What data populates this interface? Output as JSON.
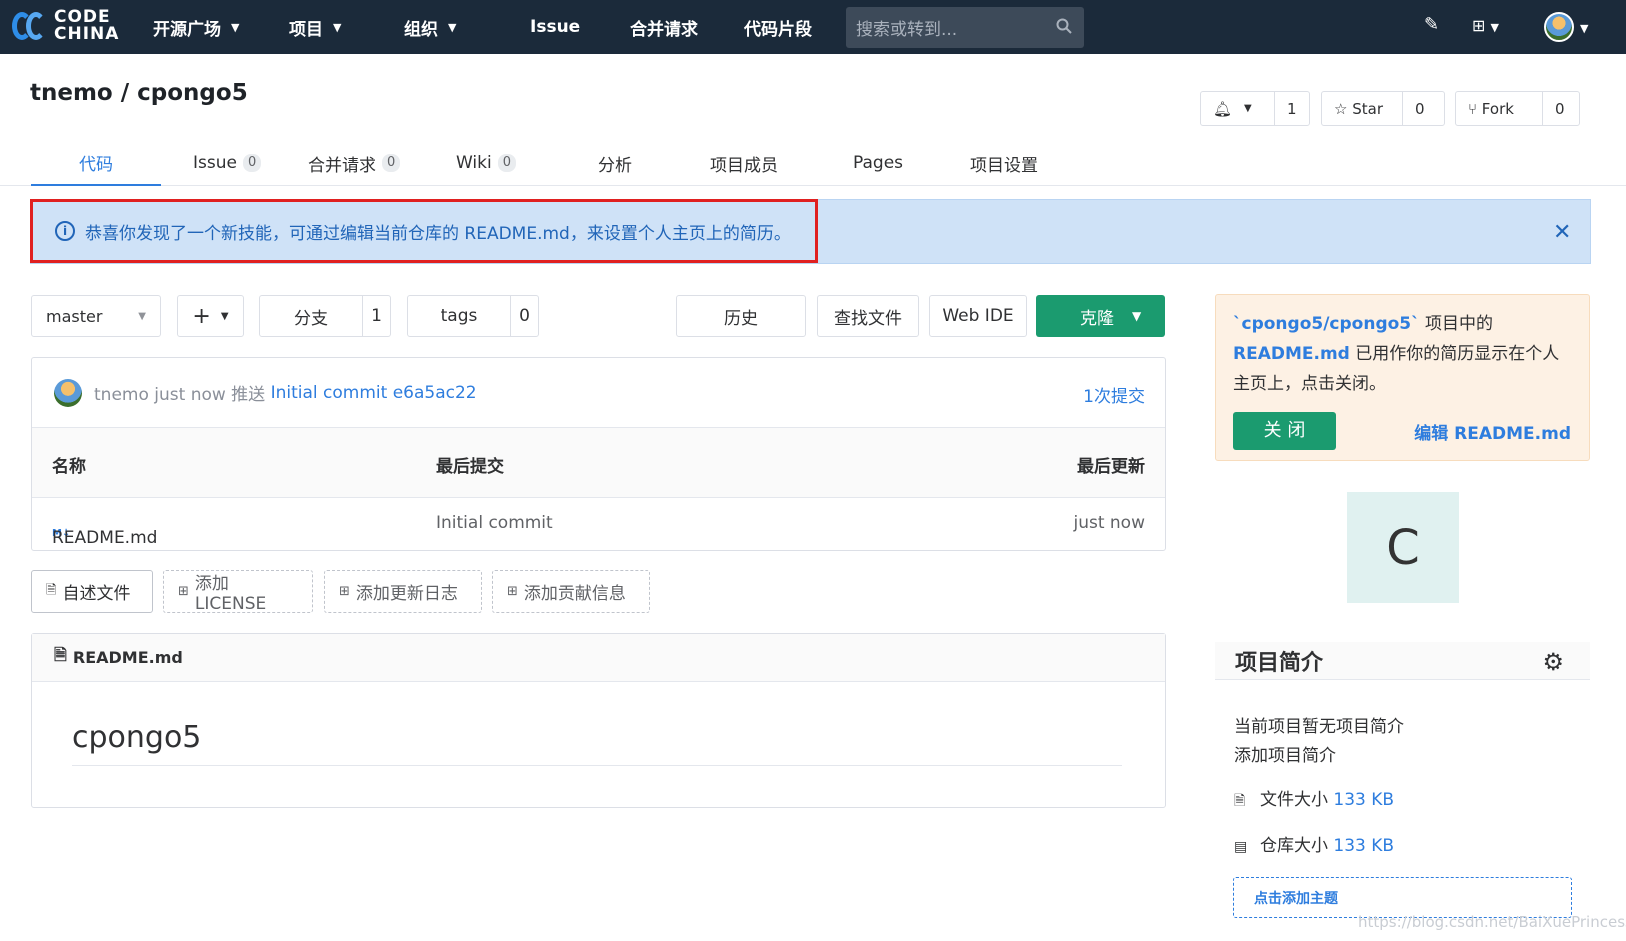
{
  "topbar": {
    "logo_line1": "CODE",
    "logo_line2": "CHINA",
    "nav": [
      "开源广场",
      "项目",
      "组织",
      "Issue",
      "合并请求",
      "代码片段"
    ],
    "search_placeholder": "搜索或转到..."
  },
  "repo": {
    "title": "tnemo / cpongo5",
    "watch_count": "1",
    "star_label": "Star",
    "star_count": "0",
    "fork_label": "Fork",
    "fork_count": "0"
  },
  "tabs": [
    {
      "label": "代码"
    },
    {
      "label": "Issue",
      "count": "0"
    },
    {
      "label": "合并请求",
      "count": "0"
    },
    {
      "label": "Wiki",
      "count": "0"
    },
    {
      "label": "分析"
    },
    {
      "label": "项目成员"
    },
    {
      "label": "Pages"
    },
    {
      "label": "项目设置"
    }
  ],
  "alert": {
    "text": "恭喜你发现了一个新技能，可通过编辑当前仓库的 README.md，来设置个人主页上的简历。"
  },
  "toolbar": {
    "branch": "master",
    "plus": "+",
    "branches_label": "分支",
    "branches_count": "1",
    "tags_label": "tags",
    "tags_count": "0",
    "history": "历史",
    "find_file": "查找文件",
    "web_ide": "Web IDE",
    "clone": "克隆"
  },
  "commit": {
    "meta": "tnemo just now 推送",
    "message": "Initial commit",
    "sha": "e6a5ac22",
    "count": "1次提交"
  },
  "table": {
    "headers": [
      "名称",
      "最后提交",
      "最后更新"
    ],
    "rows": [
      {
        "icon": "M↓",
        "name": "README.md",
        "commit": "Initial commit",
        "updated": "just now"
      }
    ]
  },
  "add_buttons": [
    "自述文件",
    "添加LICENSE",
    "添加更新日志",
    "添加贡献信息"
  ],
  "readme": {
    "filename": "README.md",
    "heading": "cpongo5"
  },
  "notice": {
    "part1": "`cpongo5/cpongo5`",
    "part2": " 项目中的",
    "part3": "README.md",
    "part4": " 已用作你的简历显示在个人主页上，点击关闭。",
    "close": "关 闭",
    "edit": "编辑 README.md"
  },
  "project_avatar_letter": "C",
  "intro": {
    "title": "项目简介",
    "empty": "当前项目暂无项目简介",
    "add": "添加项目简介",
    "file_size_label": "文件大小",
    "file_size": "133 KB",
    "repo_size_label": "仓库大小",
    "repo_size": "133 KB",
    "add_topic": "点击添加主题"
  },
  "watermark": "https://blog.csdn.net/BaiXuePrincess"
}
